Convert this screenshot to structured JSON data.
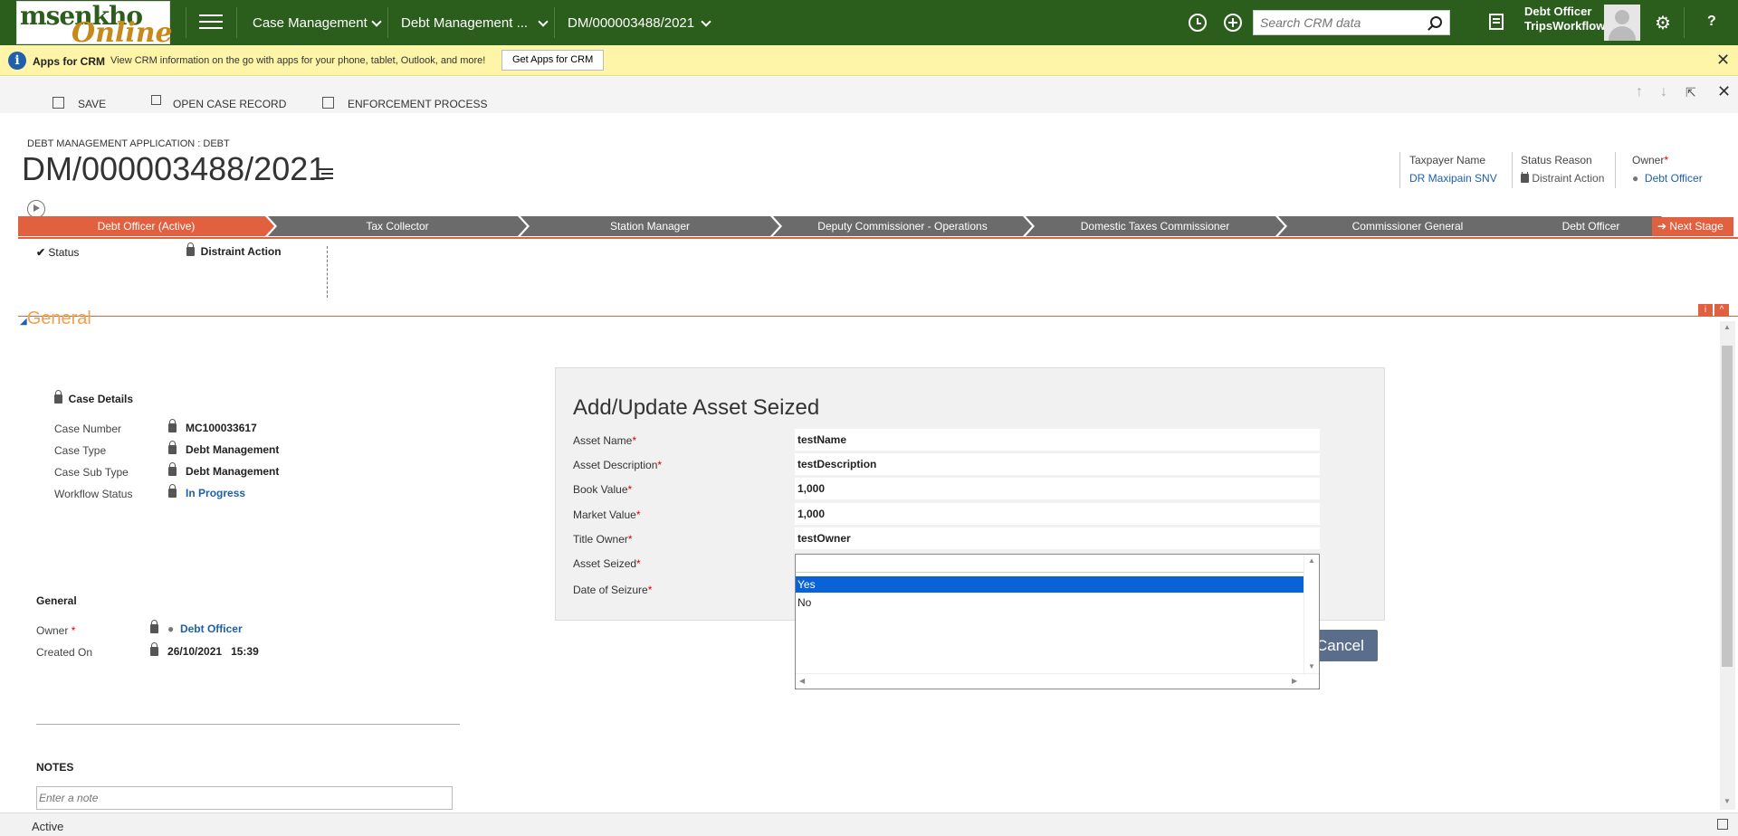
{
  "app": {
    "logo_top": "msenkho",
    "logo_bottom": "Online",
    "nav": {
      "case_management": "Case Management",
      "debt_management": "Debt Management ...",
      "record_id": "DM/000003488/2021"
    },
    "search_placeholder": "Search CRM data",
    "user_name": "Debt Officer",
    "user_org": "TripsWorkflow",
    "help": "?"
  },
  "notification": {
    "title": "Apps for CRM",
    "text": "View CRM information on the go with apps for your phone, tablet, Outlook, and more!",
    "button": "Get Apps for CRM"
  },
  "commands": {
    "save": "SAVE",
    "open_case": "OPEN CASE RECORD",
    "enforcement": "ENFORCEMENT PROCESS"
  },
  "header": {
    "entity_type": "DEBT MANAGEMENT APPLICATION : DEBT",
    "title": "DM/000003488/2021",
    "taxpayer_label": "Taxpayer Name",
    "taxpayer_value": "DR Maxipain SNV",
    "status_reason_label": "Status Reason",
    "status_reason_value": "Distraint Action",
    "owner_label": "Owner",
    "owner_value": "Debt Officer"
  },
  "process": {
    "stages": [
      "Debt Officer (Active)",
      "Tax Collector",
      "Station Manager",
      "Deputy Commissioner - Operations",
      "Domestic Taxes Commissioner",
      "Commissioner General",
      "Debt Officer"
    ],
    "next_stage": "Next Stage",
    "status_label": "Status",
    "status_value": "Distraint Action"
  },
  "form": {
    "section_title": "General",
    "case_details_title": "Case Details",
    "case_number_label": "Case Number",
    "case_number": "MC100033617",
    "case_type_label": "Case Type",
    "case_type": "Debt Management",
    "case_sub_type_label": "Case Sub Type",
    "case_sub_type": "Debt Management",
    "workflow_status_label": "Workflow Status",
    "workflow_status": "In Progress",
    "general_title": "General",
    "owner_label": "Owner",
    "owner_value": "Debt Officer",
    "created_on_label": "Created On",
    "created_on": "26/10/2021   15:39",
    "notes_title": "NOTES",
    "note_placeholder": "Enter a note"
  },
  "dialog": {
    "title": "Add/Update Asset Seized",
    "asset_name_label": "Asset Name",
    "asset_name": "testName",
    "asset_description_label": "Asset Description",
    "asset_description": "testDescription",
    "book_value_label": "Book Value",
    "book_value": "1,000",
    "market_value_label": "Market Value",
    "market_value": "1,000",
    "title_owner_label": "Title Owner",
    "title_owner": "testOwner",
    "asset_seized_label": "Asset Seized",
    "date_of_seizure_label": "Date of Seizure",
    "cancel": "Cancel",
    "dropdown_options": [
      "Yes",
      "No"
    ]
  },
  "statusbar": {
    "status": "Active"
  },
  "colors": {
    "nav_green": "#2b5d1c",
    "accent_orange": "#e06040",
    "link_blue": "#1e5fae",
    "select_blue": "#0a63d6"
  }
}
